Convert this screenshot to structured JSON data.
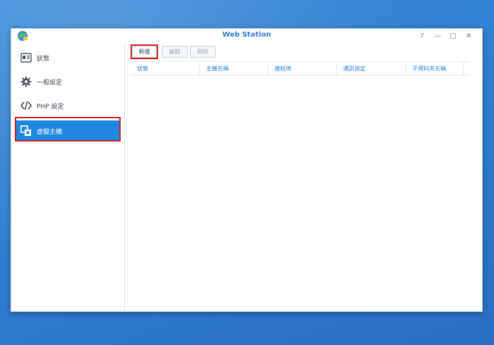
{
  "window": {
    "title": "Web Station",
    "app_icon": "web-station-globe-icon",
    "controls": [
      {
        "name": "help-button",
        "glyph": "?"
      },
      {
        "name": "minimize-button",
        "glyph": "—"
      },
      {
        "name": "maximize-button",
        "glyph": "□"
      },
      {
        "name": "close-button",
        "glyph": "✕"
      }
    ]
  },
  "sidebar": {
    "items": [
      {
        "label": "狀態",
        "icon": "id-card-icon"
      },
      {
        "label": "一般設定",
        "icon": "gear-icon"
      },
      {
        "label": "PHP 設定",
        "icon": "code-icon"
      },
      {
        "label": "虛擬主機",
        "icon": "virtual-host-icon",
        "active": true
      }
    ]
  },
  "toolbar": {
    "create_label": "新增",
    "edit_label": "編輯",
    "delete_label": "刪除"
  },
  "table": {
    "columns": [
      "狀態",
      "主機名稱",
      "連結埠",
      "通訊協定",
      "子資料夾名稱"
    ],
    "rows": []
  },
  "colors": {
    "accent": "#1f87df",
    "highlight": "#d11f28",
    "header_text": "#2b82d6"
  }
}
